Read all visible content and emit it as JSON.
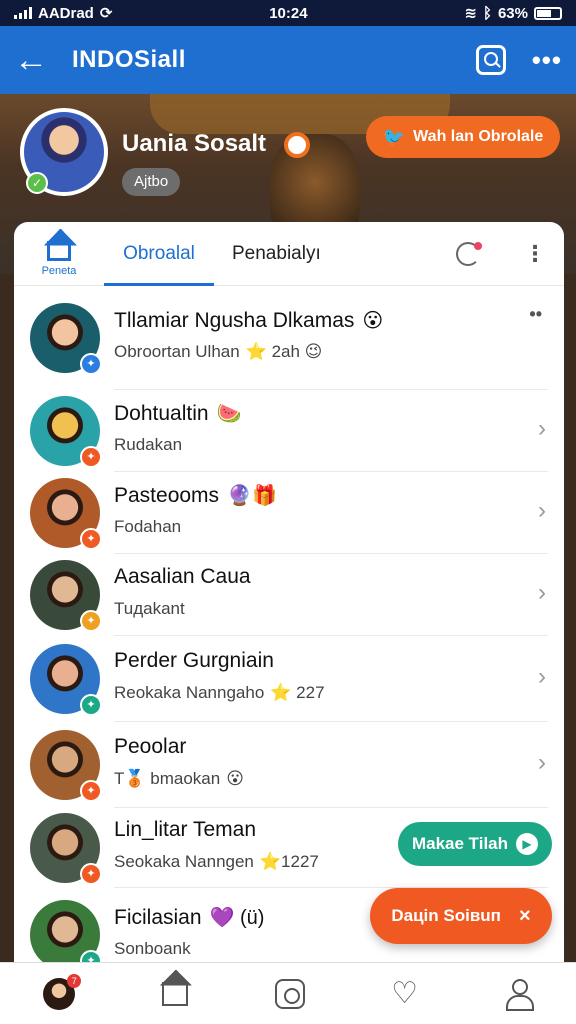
{
  "status_bar": {
    "carrier": "AADrad",
    "time": "10:24",
    "battery": "63%"
  },
  "app_bar": {
    "title": "INDOSiall"
  },
  "profile": {
    "name": "Uania Sosalt",
    "tag": "Ajtbo",
    "follow_label": "Wah lan Obrolale"
  },
  "tabs": {
    "home_label": "Peneta",
    "active_label": "Obroalal",
    "other_label": "Penabialyı"
  },
  "list": [
    {
      "title": "Tllamiar Ngusha Dlkamas",
      "title_emoji": "😮",
      "subtitle": "Obroortan Ulhan",
      "subtitle_extra": "⭐ 2ah 😉",
      "accessory": "dots",
      "badge_color": "#2a7de1"
    },
    {
      "title": "Dohtualtin",
      "title_emoji": "🍉",
      "subtitle": "Rudakan",
      "subtitle_extra": "",
      "accessory": "chevron",
      "badge_color": "#f05a22"
    },
    {
      "title": "Pasteooms",
      "title_emoji": "🔮🎁",
      "subtitle": "Fodahan",
      "subtitle_extra": "",
      "accessory": "chevron",
      "badge_color": "#f05a22"
    },
    {
      "title": "Aasalian Caua",
      "title_emoji": "",
      "subtitle": "Tuдakant",
      "subtitle_extra": "",
      "accessory": "chevron",
      "badge_color": "#f0a020"
    },
    {
      "title": "Perder Gurgniain",
      "title_emoji": "",
      "subtitle": "Reokaka Nanngaho",
      "subtitle_extra": "⭐ 227",
      "accessory": "chevron",
      "badge_color": "#1ca886"
    },
    {
      "title": "Peoolar",
      "title_emoji": "",
      "subtitle": "T🥉 bmaokan",
      "subtitle_extra": "😮",
      "accessory": "chevron",
      "badge_color": "#f05a22"
    },
    {
      "title": "Lin_litar Teman",
      "title_emoji": "",
      "subtitle": "Seokaka Nanngen",
      "subtitle_extra": "⭐1227",
      "accessory": "none",
      "badge_color": "#f05a22"
    },
    {
      "title": "Ficilasian",
      "title_emoji": "💜 (ü)",
      "subtitle": "Sonboank",
      "subtitle_extra": "",
      "accessory": "none",
      "badge_color": "#1ca886"
    }
  ],
  "fab_green": {
    "label": "Makae Tilah"
  },
  "fab_orange": {
    "label": "Daцin Soiвuп",
    "close": "×"
  },
  "bottom_nav": {
    "avatar_badge": "7"
  }
}
